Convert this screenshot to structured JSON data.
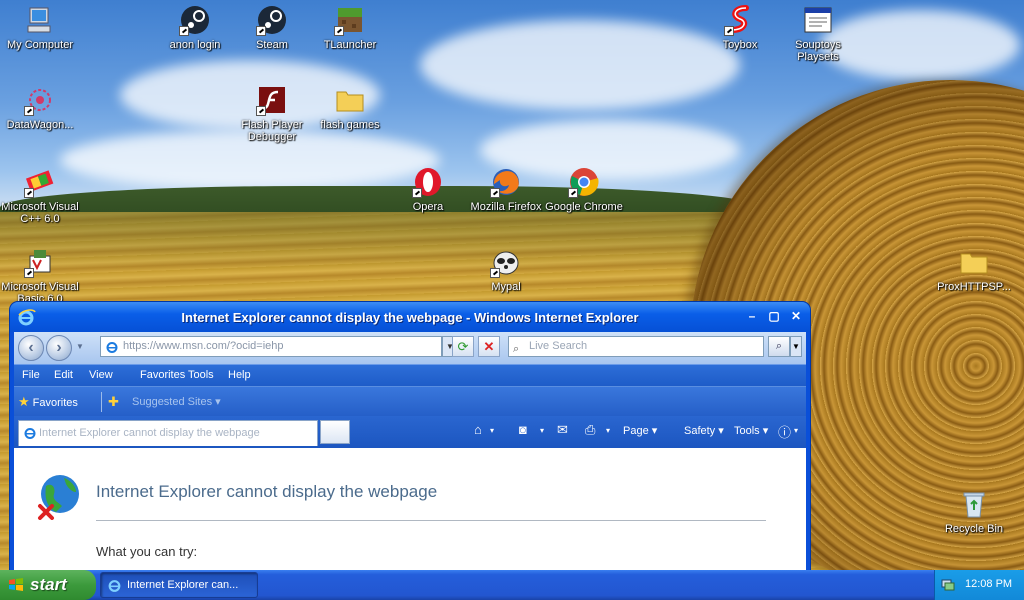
{
  "desktop": {
    "icons": {
      "my_computer": "My Computer",
      "anon_login": "anon login",
      "steam": "Steam",
      "tlauncher": "TLauncher",
      "toybox": "Toybox",
      "souptoys": "Souptoys Playsets",
      "datawagon": "DataWagon...",
      "flash_player": "Flash Player Debugger",
      "flash_games": "flash games",
      "msvc": "Microsoft Visual C++ 6.0",
      "opera": "Opera",
      "firefox": "Mozilla Firefox",
      "chrome": "Google Chrome",
      "msvb": "Microsoft Visual Basic 6.0",
      "mypal": "Mypal",
      "proxhttp": "ProxHTTPSP...",
      "recycle_bin": "Recycle Bin"
    }
  },
  "window": {
    "title": "Internet Explorer cannot display the webpage - Windows Internet Explorer",
    "address_domain": "https://www.msn.com/",
    "address_path": "?ocid=iehp",
    "search_placeholder": "Live Search",
    "menu": [
      "File",
      "Edit",
      "View",
      "Favorites",
      "Tools",
      "Help"
    ],
    "favorites_label": "Favorites",
    "suggested_sites": "Suggested Sites",
    "tab_title": "Internet Explorer cannot display the webpage",
    "commands": {
      "page": "Page",
      "safety": "Safety",
      "tools": "Tools"
    },
    "error_heading": "Internet Explorer cannot display the webpage",
    "what_you_can_try": "What you can try:"
  },
  "taskbar": {
    "start_label": "start",
    "task_button": "Internet Explorer can...",
    "clock": "12:08 PM"
  },
  "colors": {
    "taskbar_blue": "#245edb",
    "start_green": "#3c9a3c",
    "title_blue": "#0a5ee8",
    "error_heading": "#4b6b8c"
  }
}
